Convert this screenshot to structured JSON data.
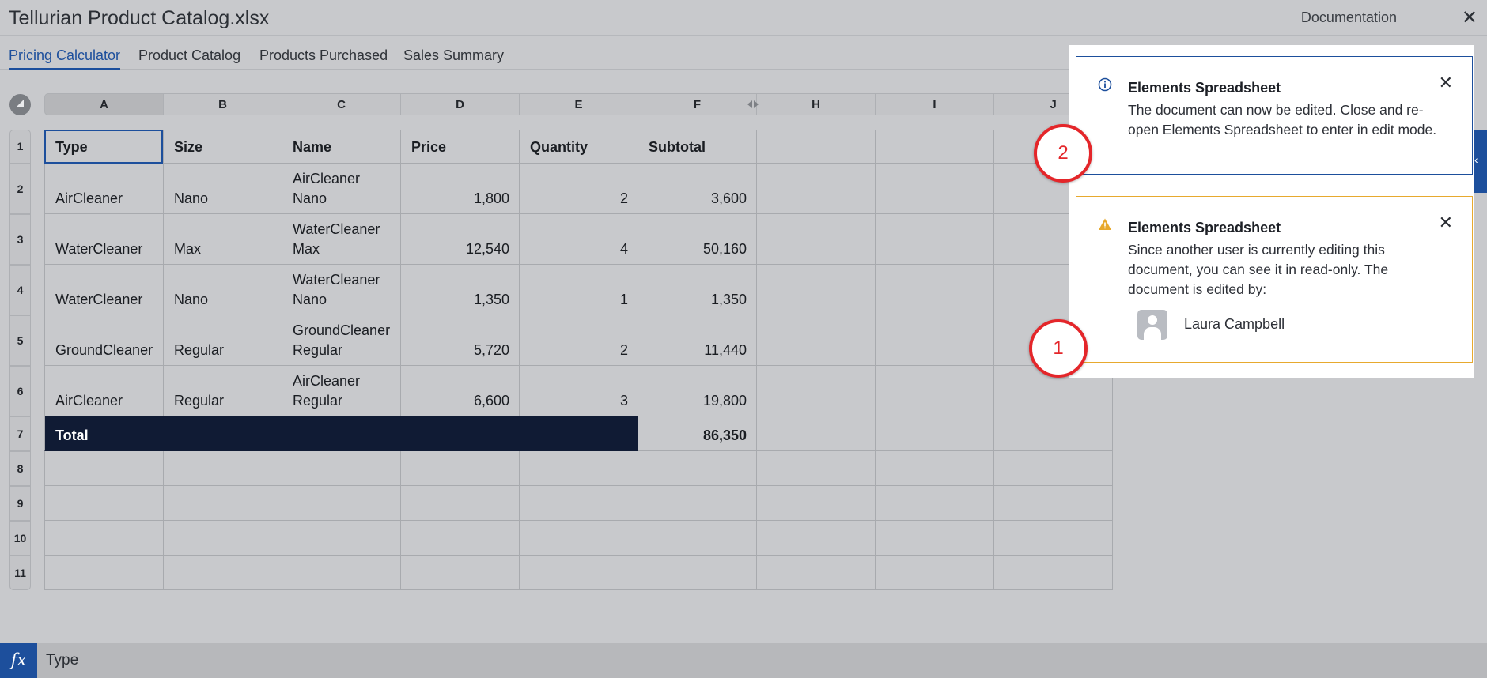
{
  "window": {
    "title": "Tellurian Product Catalog.xlsx",
    "documentation_label": "Documentation",
    "close_glyph": "✕"
  },
  "tabs": [
    {
      "label": "Pricing Calculator",
      "active": true
    },
    {
      "label": "Product Catalog",
      "active": false
    },
    {
      "label": "Products Purchased",
      "active": false
    },
    {
      "label": "Sales Summary",
      "active": false
    }
  ],
  "columns": [
    "A",
    "B",
    "C",
    "D",
    "E",
    "F",
    "H",
    "I",
    "J"
  ],
  "rows": [
    "1",
    "2",
    "3",
    "4",
    "5",
    "6",
    "7",
    "8",
    "9",
    "10",
    "11"
  ],
  "sheet": {
    "headers": [
      "Type",
      "Size",
      "Name",
      "Price",
      "Quantity",
      "Subtotal"
    ],
    "data": [
      {
        "type": "AirCleaner",
        "size": "Nano",
        "name1": "AirCleaner",
        "name2": "Nano",
        "price": "1,800",
        "qty": "2",
        "subtotal": "3,600"
      },
      {
        "type": "WaterCleaner",
        "size": "Max",
        "name1": "WaterCleaner",
        "name2": "Max",
        "price": "12,540",
        "qty": "4",
        "subtotal": "50,160"
      },
      {
        "type": "WaterCleaner",
        "size": "Nano",
        "name1": "WaterCleaner",
        "name2": "Nano",
        "price": "1,350",
        "qty": "1",
        "subtotal": "1,350"
      },
      {
        "type": "GroundCleaner",
        "size": "Regular",
        "name1": "GroundCleaner",
        "name2": "Regular",
        "price": "5,720",
        "qty": "2",
        "subtotal": "11,440"
      },
      {
        "type": "AirCleaner",
        "size": "Regular",
        "name1": "AirCleaner",
        "name2": "Regular",
        "price": "6,600",
        "qty": "3",
        "subtotal": "19,800"
      }
    ],
    "total_label": "Total",
    "total_value": "86,350"
  },
  "formula_bar": {
    "fx_label": "fx",
    "value": "Type"
  },
  "notifications": {
    "info": {
      "title": "Elements Spreadsheet",
      "body": "The document can now be edited. Close and re-open Elements Spreadsheet to enter in edit mode.",
      "icon": "info-icon"
    },
    "warning": {
      "title": "Elements Spreadsheet",
      "body": "Since another user is currently editing this document, you can see it in read-only. The document is edited by:",
      "icon": "warning-icon",
      "user": "Laura Campbell"
    },
    "close_glyph": "✕"
  },
  "markers": {
    "first": "1",
    "second": "2"
  },
  "colors": {
    "accent": "#1d4f9c",
    "warning": "#e7a92e",
    "marker": "#e4262a",
    "total_fill": "#101b34"
  }
}
